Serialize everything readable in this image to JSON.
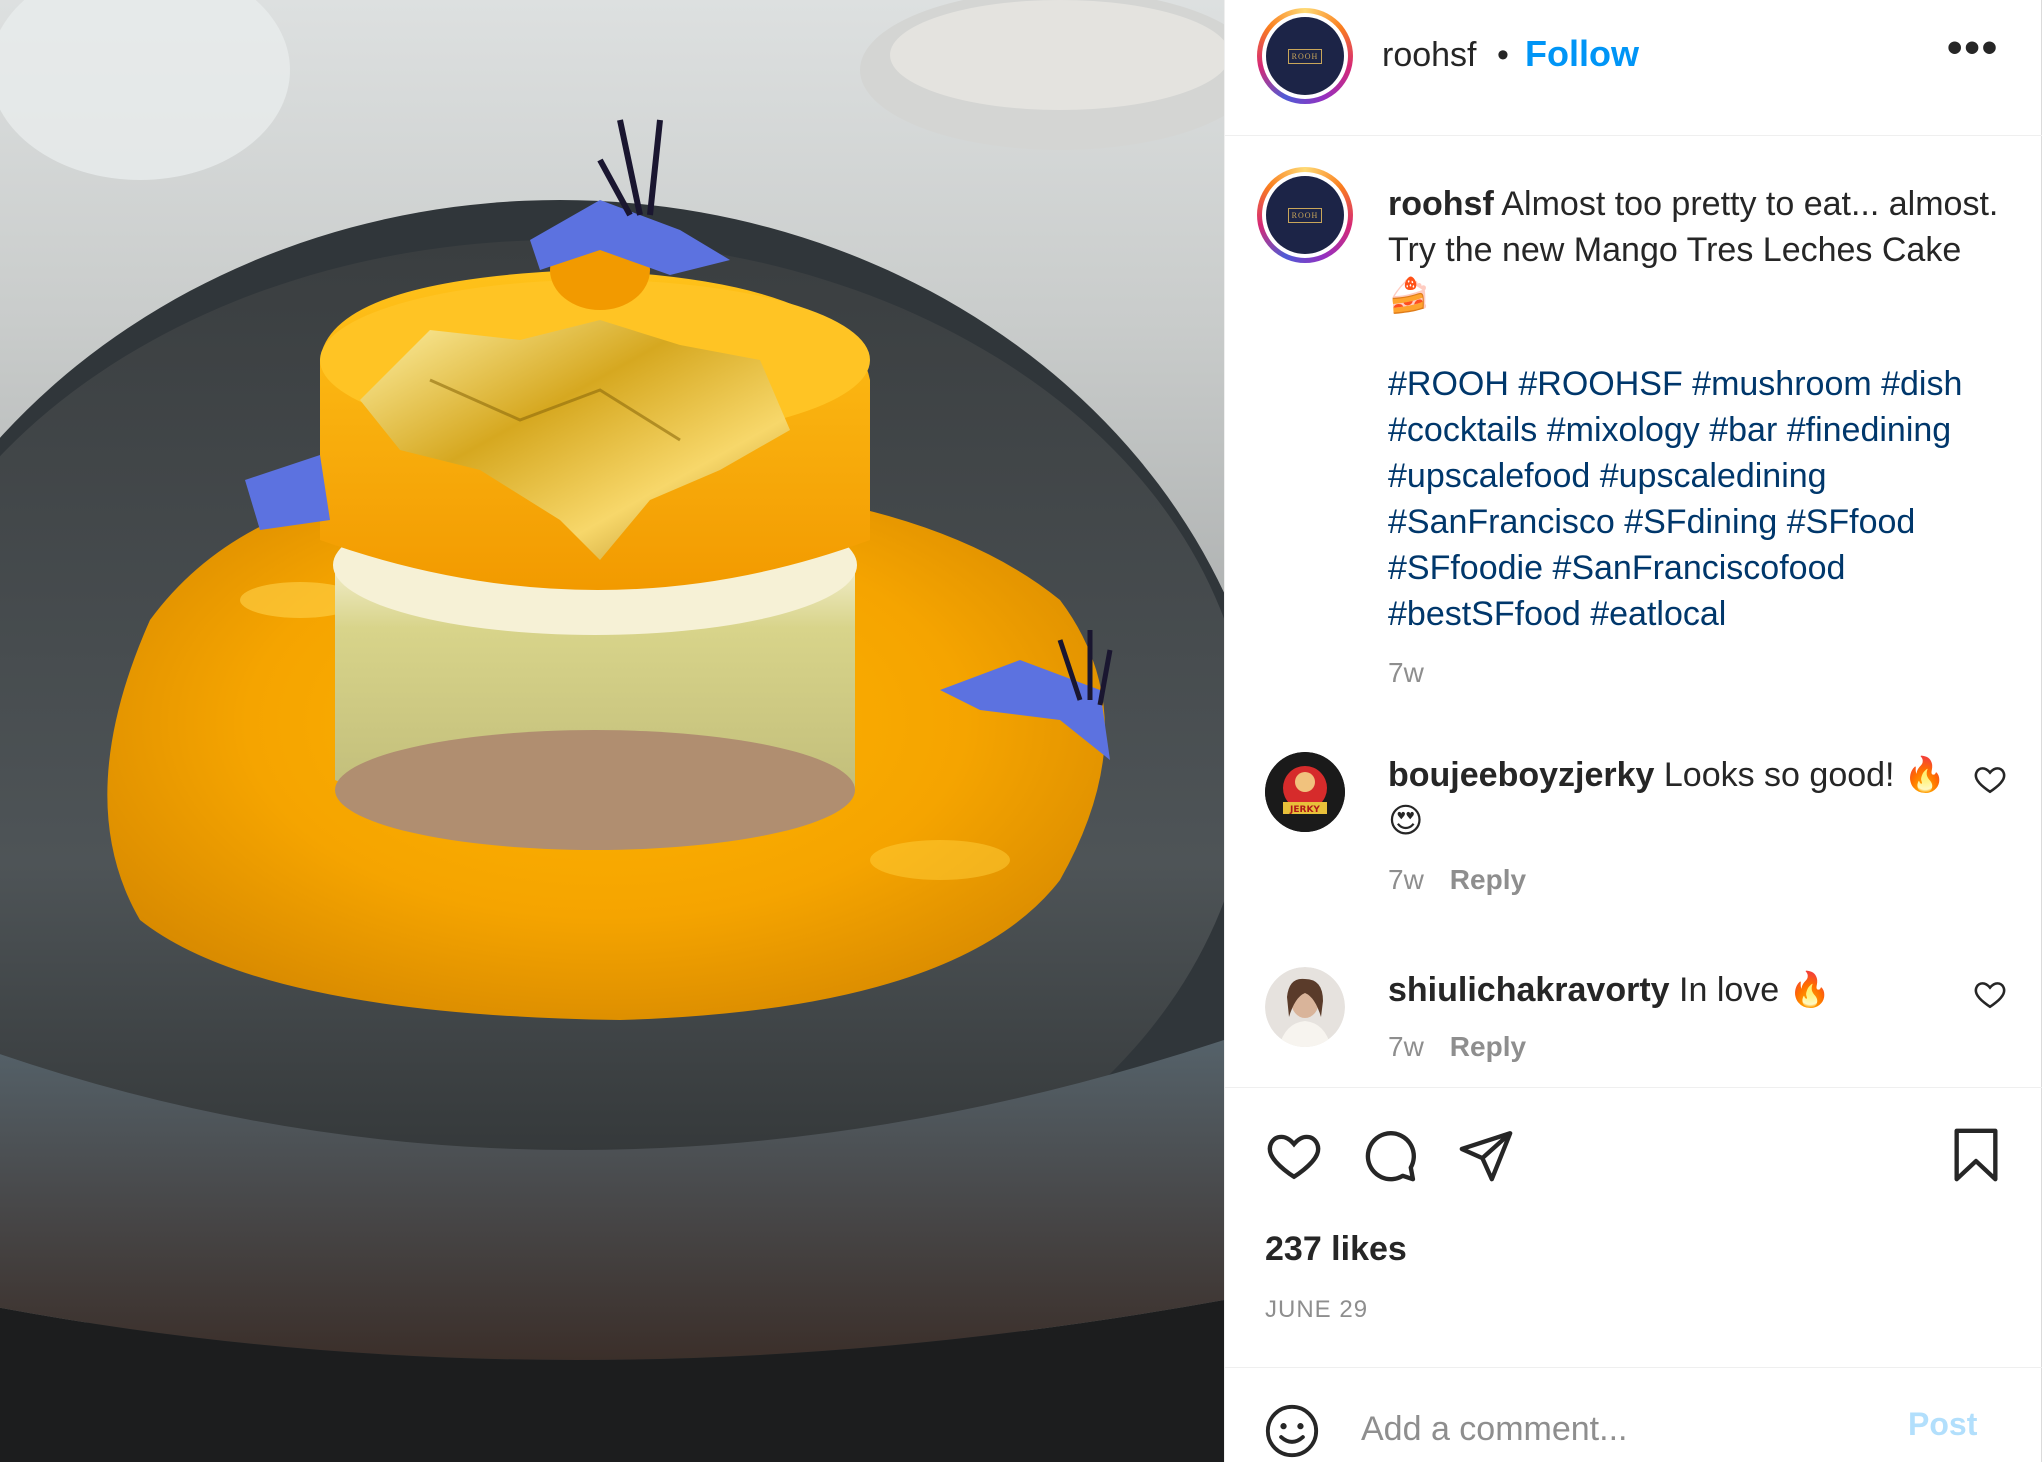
{
  "post": {
    "username": "roohsf",
    "follow_label": "Follow",
    "separator": "•",
    "more_label": "•••",
    "logo_text": "ROOH",
    "caption_text": "Almost too pretty to eat... almost. Try the new Mango Tres Leches Cake 🍰",
    "hashtags": "#ROOH #ROOHSF #mushroom #dish #cocktails #mixology #bar #finedining #upscalefood #upscaledining #SanFrancisco #SFdining #SFfood #SFfoodie #SanFranciscofood #bestSFfood #eatlocal",
    "caption_time": "7w"
  },
  "comments": [
    {
      "username": "boujeeboyzjerky",
      "text": "Looks so good! 🔥 😍",
      "time": "7w",
      "reply_label": "Reply",
      "avatar_text": "JERKY"
    },
    {
      "username": "shiulichakravorty",
      "text": "In love 🔥",
      "time": "7w",
      "reply_label": "Reply"
    }
  ],
  "actions": {
    "likes": "237 likes",
    "date": "JUNE 29"
  },
  "composer": {
    "placeholder": "Add a comment...",
    "post_label": "Post"
  },
  "colors": {
    "link": "#0095f6",
    "hashtag": "#00376b",
    "muted": "#8e8e8e",
    "post_disabled": "#b2dffc"
  },
  "icons": {
    "like": "heart-icon",
    "comment": "comment-bubble-icon",
    "share": "paper-plane-icon",
    "save": "bookmark-icon",
    "emoji": "smiley-icon",
    "more": "more-dots-icon"
  }
}
